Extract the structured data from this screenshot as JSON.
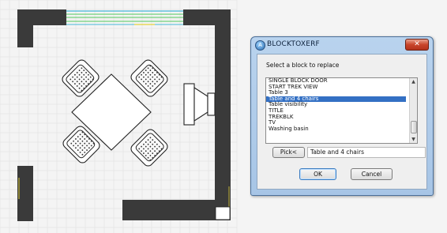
{
  "dialog": {
    "title": "BLOCKTOXERF",
    "app_icon": "autocad-a-icon",
    "app_icon_glyph": "A",
    "close_icon": "close-icon",
    "close_glyph": "✕",
    "prompt": "Select a block to replace",
    "list_items": [
      "SINGLE BLOCK DOOR",
      "START TREK VIEW",
      "Table 3",
      "Table and 4 chairs",
      "Table visibility",
      "TITLE",
      "TREKBLK",
      "TV",
      "Washing basin"
    ],
    "selected_item": "Table and 4 chairs",
    "scroll_up_glyph": "▲",
    "scroll_down_glyph": "▼",
    "pick_label": "Pick<",
    "pick_value": "Table and 4 chairs",
    "ok_label": "OK",
    "cancel_label": "Cancel"
  },
  "colors": {
    "titlebar": "#b9d3ee",
    "selection": "#3370c4",
    "wall": "#3a3a3a",
    "close_button": "#c9452b"
  }
}
